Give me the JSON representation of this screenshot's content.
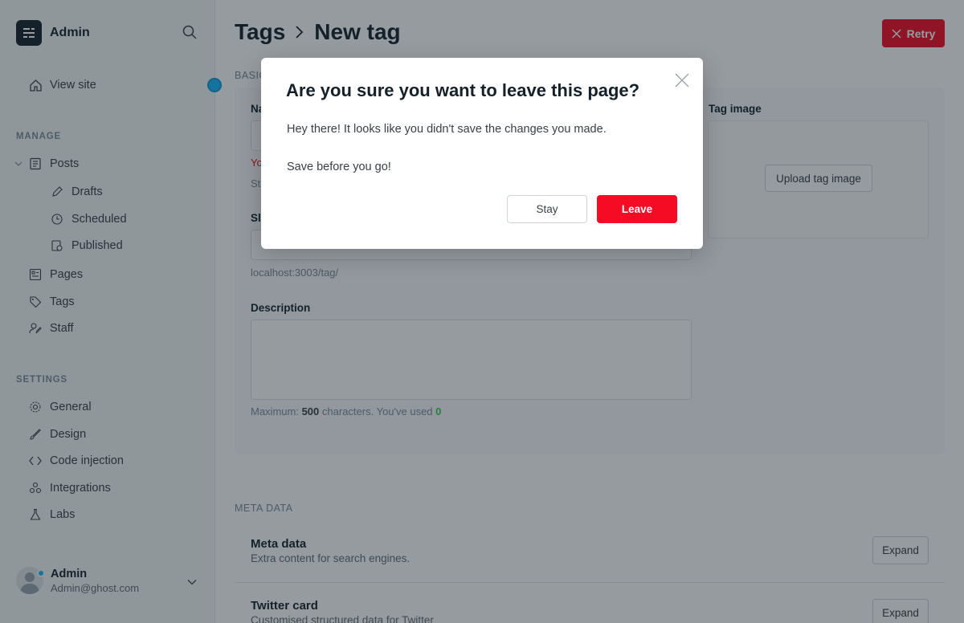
{
  "sidebar": {
    "brand": "Admin",
    "view_site": "View site",
    "manage_label": "MANAGE",
    "posts": "Posts",
    "drafts": "Drafts",
    "scheduled": "Scheduled",
    "published": "Published",
    "pages": "Pages",
    "tags": "Tags",
    "staff": "Staff",
    "settings_label": "SETTINGS",
    "general": "General",
    "design": "Design",
    "code_injection": "Code injection",
    "integrations": "Integrations",
    "labs": "Labs",
    "user_name": "Admin",
    "user_email": "Admin@ghost.com"
  },
  "header": {
    "breadcrumb_parent": "Tags",
    "breadcrumb_current": "New tag",
    "retry_label": "Retry"
  },
  "form": {
    "basic_label": "BASIC",
    "name_label": "Name",
    "name_error": "You",
    "name_help": "Start",
    "slug_label": "Slug",
    "slug_url": "localhost:3003/tag/",
    "description_label": "Description",
    "desc_max_prefix": "Maximum:",
    "desc_max_value": "500",
    "desc_max_mid": "characters. You've used",
    "desc_used": "0",
    "tag_image_label": "Tag image",
    "upload_label": "Upload tag image"
  },
  "meta": {
    "section_label": "META DATA",
    "meta_title": "Meta data",
    "meta_sub": "Extra content for search engines.",
    "twitter_title": "Twitter card",
    "twitter_sub": "Customised structured data for Twitter",
    "expand_label": "Expand"
  },
  "modal": {
    "title": "Are you sure you want to leave this page?",
    "line1": "Hey there! It looks like you didn't save the changes you made.",
    "line2": "Save before you go!",
    "stay_label": "Stay",
    "leave_label": "Leave"
  },
  "colors": {
    "accent": "#f50b23",
    "dark": "#15212a",
    "blue": "#14b8ff",
    "green": "#30cf43"
  }
}
